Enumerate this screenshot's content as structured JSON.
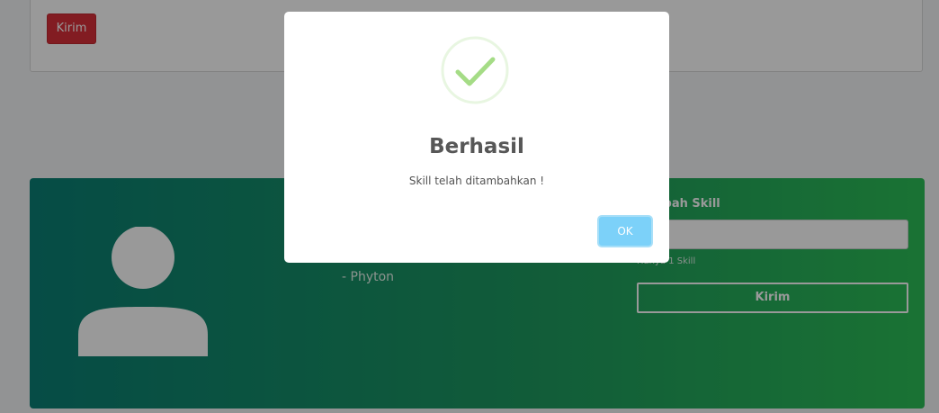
{
  "top_form": {
    "send_label": "Kirim"
  },
  "profile": {
    "skills": [
      "- Phyton"
    ]
  },
  "add_skill": {
    "title": "Tambah Skill",
    "input_value": "",
    "hint": "Hanya 1 Skill",
    "send_label": "Kirim"
  },
  "dialog": {
    "icon": "success-check-icon",
    "title": "Berhasil",
    "message": "Skill telah ditambahkan !",
    "ok_label": "OK"
  },
  "colors": {
    "danger": "#d9303a",
    "gradient_start": "#0a7f75",
    "gradient_end": "#2cbf57",
    "success_check": "#a5dc86",
    "ok_button": "#7cd1f9"
  }
}
